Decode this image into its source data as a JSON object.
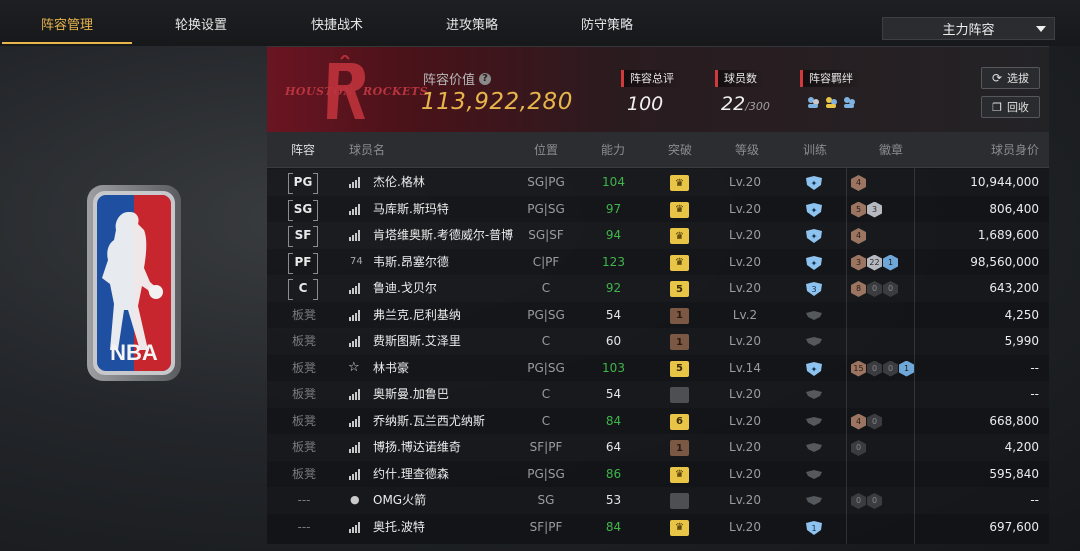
{
  "tabs": [
    {
      "label": "阵容管理",
      "active": true
    },
    {
      "label": "轮换设置",
      "active": false
    },
    {
      "label": "快捷战术",
      "active": false
    },
    {
      "label": "进攻策略",
      "active": false
    },
    {
      "label": "防守策略",
      "active": false
    }
  ],
  "lineup_select": {
    "value": "主力阵容",
    "icon": "chevron-down-icon"
  },
  "team": {
    "logo_top": "HOUSTON",
    "logo_bottom": "ROCKETS",
    "value_label": "阵容价值",
    "value": "113,922,280",
    "overall_label": "阵容总评",
    "overall": "100",
    "count_label": "球员数",
    "count": "22",
    "count_max": "/300",
    "bond_label": "阵容羁绊",
    "pick_button": "选拔",
    "recycle_button": "回收"
  },
  "columns": [
    "阵容",
    "球员名",
    "位置",
    "能力",
    "突破",
    "等级",
    "训练",
    "徽章",
    "球员身价"
  ],
  "colors": {
    "accent": "#e8b44c",
    "ability_green": "#3fb54a",
    "ability_white": "#e6e6e6",
    "red": "#d03a3a"
  },
  "rows": [
    {
      "slot": "PG",
      "starter": true,
      "icon": "signal",
      "name": "杰伦.格林",
      "position": "SG|PG",
      "ability": "104",
      "green": true,
      "breakthrough": {
        "kind": "gold",
        "text": "♛"
      },
      "level": "Lv.20",
      "train": {
        "kind": "blue",
        "text": "✦"
      },
      "badges": [
        {
          "k": "b",
          "t": "4"
        }
      ],
      "price": "10,944,000"
    },
    {
      "slot": "SG",
      "starter": true,
      "icon": "signal",
      "name": "马库斯.斯玛特",
      "position": "PG|SG",
      "ability": "97",
      "green": true,
      "breakthrough": {
        "kind": "gold",
        "text": "♛"
      },
      "level": "Lv.20",
      "train": {
        "kind": "blue",
        "text": "✦"
      },
      "badges": [
        {
          "k": "b",
          "t": "5"
        },
        {
          "k": "s",
          "t": "3"
        }
      ],
      "price": "806,400"
    },
    {
      "slot": "SF",
      "starter": true,
      "icon": "signal",
      "name": "肯塔维奥斯.考德威尔-普博",
      "position": "SG|SF",
      "ability": "94",
      "green": true,
      "breakthrough": {
        "kind": "gold",
        "text": "♛"
      },
      "level": "Lv.20",
      "train": {
        "kind": "blue",
        "text": "✦"
      },
      "badges": [
        {
          "k": "b",
          "t": "4"
        }
      ],
      "price": "1,689,600"
    },
    {
      "slot": "PF",
      "starter": true,
      "icon": "jersey",
      "jersey": "74",
      "name": "韦斯.昂塞尔德",
      "position": "C|PF",
      "ability": "123",
      "green": true,
      "breakthrough": {
        "kind": "gold",
        "text": "♛"
      },
      "level": "Lv.20",
      "train": {
        "kind": "blue",
        "text": "✦"
      },
      "badges": [
        {
          "k": "b",
          "t": "3"
        },
        {
          "k": "s",
          "t": "22"
        },
        {
          "k": "l",
          "t": "1"
        }
      ],
      "price": "98,560,000"
    },
    {
      "slot": "C",
      "starter": true,
      "icon": "signal",
      "name": "鲁迪.戈贝尔",
      "position": "C",
      "ability": "92",
      "green": true,
      "breakthrough": {
        "kind": "gold",
        "text": "5"
      },
      "level": "Lv.20",
      "train": {
        "kind": "blue",
        "text": "3"
      },
      "badges": [
        {
          "k": "b",
          "t": "8"
        },
        {
          "k": "g",
          "t": "0"
        },
        {
          "k": "g",
          "t": "0"
        }
      ],
      "price": "643,200"
    },
    {
      "slot": "板凳",
      "starter": false,
      "icon": "signal",
      "name": "弗兰克.尼利基纳",
      "position": "PG|SG",
      "ability": "54",
      "green": false,
      "breakthrough": {
        "kind": "bronze",
        "text": "1"
      },
      "level": "Lv.2",
      "train": {
        "kind": "gray",
        "text": ""
      },
      "badges": [],
      "price": "4,250"
    },
    {
      "slot": "板凳",
      "starter": false,
      "icon": "signal",
      "name": "费斯图斯.艾泽里",
      "position": "C",
      "ability": "60",
      "green": false,
      "breakthrough": {
        "kind": "bronze",
        "text": "1"
      },
      "level": "Lv.20",
      "train": {
        "kind": "gray",
        "text": ""
      },
      "badges": [],
      "price": "5,990"
    },
    {
      "slot": "板凳",
      "starter": false,
      "icon": "star",
      "name": "林书豪",
      "position": "PG|SG",
      "ability": "103",
      "green": true,
      "breakthrough": {
        "kind": "gold",
        "text": "5"
      },
      "level": "Lv.14",
      "train": {
        "kind": "blue",
        "text": "✦"
      },
      "badges": [
        {
          "k": "b",
          "t": "15"
        },
        {
          "k": "g",
          "t": "0"
        },
        {
          "k": "g",
          "t": "0"
        },
        {
          "k": "l",
          "t": "1"
        }
      ],
      "price": "--"
    },
    {
      "slot": "板凳",
      "starter": false,
      "icon": "signal",
      "name": "奥斯曼.加鲁巴",
      "position": "C",
      "ability": "54",
      "green": false,
      "breakthrough": {
        "kind": "gray",
        "text": ""
      },
      "level": "Lv.20",
      "train": {
        "kind": "gray",
        "text": ""
      },
      "badges": [],
      "price": "--"
    },
    {
      "slot": "板凳",
      "starter": false,
      "icon": "signal",
      "name": "乔纳斯.瓦兰西尤纳斯",
      "position": "C",
      "ability": "84",
      "green": true,
      "breakthrough": {
        "kind": "gold",
        "text": "6"
      },
      "level": "Lv.20",
      "train": {
        "kind": "gray",
        "text": ""
      },
      "badges": [
        {
          "k": "b",
          "t": "4"
        },
        {
          "k": "g",
          "t": "0"
        }
      ],
      "price": "668,800"
    },
    {
      "slot": "板凳",
      "starter": false,
      "icon": "signal",
      "name": "博扬.博达诺维奇",
      "position": "SF|PF",
      "ability": "64",
      "green": false,
      "breakthrough": {
        "kind": "bronze",
        "text": "1"
      },
      "level": "Lv.20",
      "train": {
        "kind": "gray",
        "text": ""
      },
      "badges": [
        {
          "k": "g",
          "t": "0"
        }
      ],
      "price": "4,200"
    },
    {
      "slot": "板凳",
      "starter": false,
      "icon": "signal",
      "name": "约什.理查德森",
      "position": "PG|SG",
      "ability": "86",
      "green": true,
      "breakthrough": {
        "kind": "gold",
        "text": "♛"
      },
      "level": "Lv.20",
      "train": {
        "kind": "gray",
        "text": ""
      },
      "badges": [],
      "price": "595,840"
    },
    {
      "slot": "---",
      "starter": false,
      "icon": "person",
      "name": "OMG火箭",
      "position": "SG",
      "ability": "53",
      "green": false,
      "breakthrough": {
        "kind": "gray",
        "text": ""
      },
      "level": "Lv.20",
      "train": {
        "kind": "gray",
        "text": ""
      },
      "badges": [
        {
          "k": "g",
          "t": "0"
        },
        {
          "k": "g",
          "t": "0"
        }
      ],
      "price": "--"
    },
    {
      "slot": "---",
      "starter": false,
      "icon": "signal",
      "name": "奥托.波特",
      "position": "SF|PF",
      "ability": "84",
      "green": true,
      "breakthrough": {
        "kind": "gold",
        "text": "♛"
      },
      "level": "Lv.20",
      "train": {
        "kind": "blue",
        "text": "1"
      },
      "badges": [],
      "price": "697,600"
    }
  ]
}
